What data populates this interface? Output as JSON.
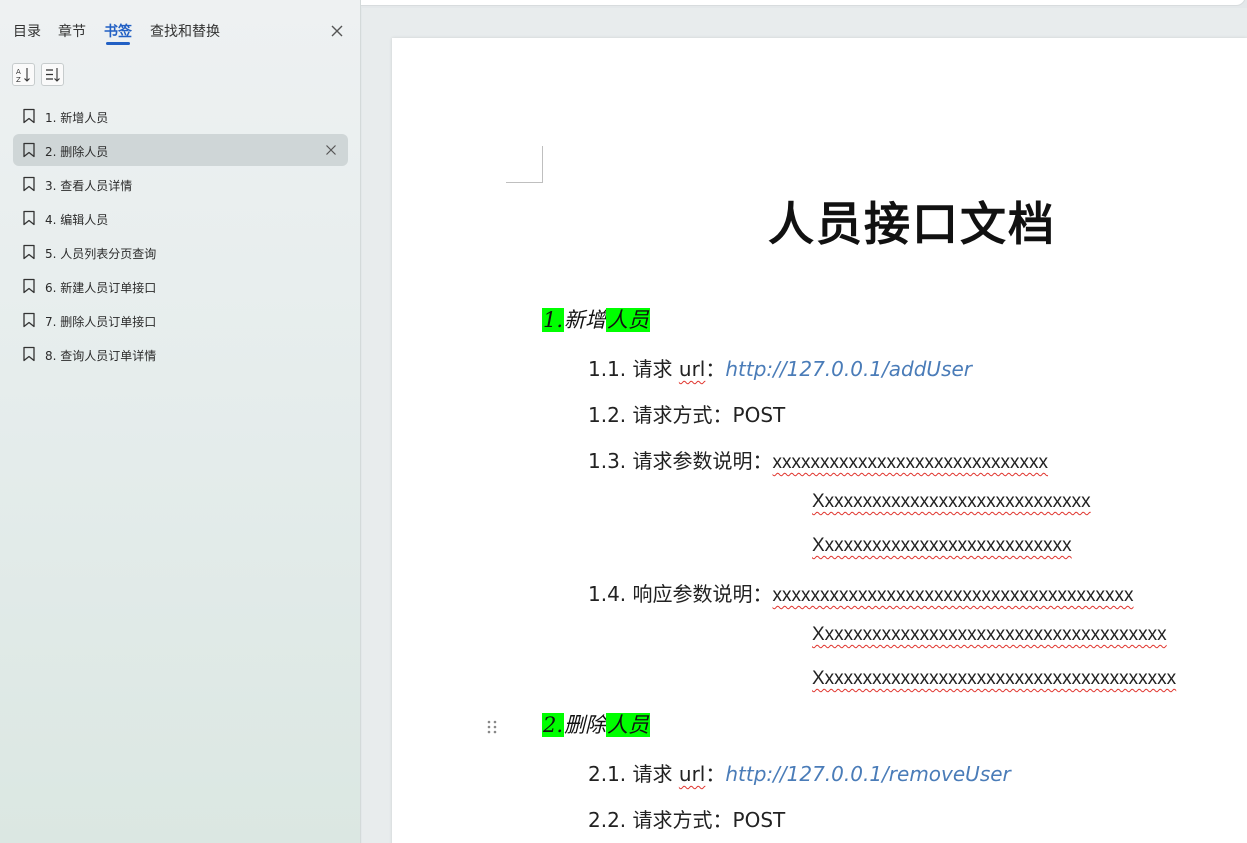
{
  "panel": {
    "tabs": [
      {
        "label": "目录"
      },
      {
        "label": "章节"
      },
      {
        "label": "书签"
      },
      {
        "label": "查找和替换"
      }
    ],
    "active_tab": "书签",
    "bookmarks": [
      {
        "label": "1. 新增人员"
      },
      {
        "label": "2. 删除人员"
      },
      {
        "label": "3. 查看人员详情"
      },
      {
        "label": "4. 编辑人员"
      },
      {
        "label": "5. 人员列表分页查询"
      },
      {
        "label": "6. 新建人员订单接口"
      },
      {
        "label": "7. 删除人员订单接口"
      },
      {
        "label": "8. 查询人员订单详情"
      }
    ],
    "selected_bookmark": "2. 删除人员"
  },
  "document": {
    "title": "人员接口文档",
    "sections": [
      {
        "number": "1.",
        "name_plain": "新增",
        "name_highlight": "人员",
        "items": [
          {
            "number": "1.1.",
            "label": "请求",
            "label_suffix": "url",
            "colon": "：",
            "value": "http://127.0.0.1/addUser"
          },
          {
            "number": "1.2.",
            "label": "请求方式：",
            "value": "POST"
          },
          {
            "number": "1.3.",
            "label": "请求参数说明：",
            "value": "xxxxxxxxxxxxxxxxxxxxxxxxxxxxx",
            "continuation": [
              "Xxxxxxxxxxxxxxxxxxxxxxxxxxxxx",
              "Xxxxxxxxxxxxxxxxxxxxxxxxxxx"
            ]
          },
          {
            "number": "1.4.",
            "label": "响应参数说明：",
            "value": "xxxxxxxxxxxxxxxxxxxxxxxxxxxxxxxxxxxxxx",
            "continuation": [
              "Xxxxxxxxxxxxxxxxxxxxxxxxxxxxxxxxxxxxx",
              "Xxxxxxxxxxxxxxxxxxxxxxxxxxxxxxxxxxxxxx"
            ]
          }
        ]
      },
      {
        "number": "2.",
        "name_plain": "删除",
        "name_highlight": "人员",
        "items": [
          {
            "number": "2.1.",
            "label": "请求",
            "label_suffix": "url",
            "colon": "：",
            "value": "http://127.0.0.1/removeUser"
          },
          {
            "number": "2.2.",
            "label": "请求方式：",
            "value": "POST"
          }
        ]
      }
    ]
  },
  "colors": {
    "accent": "#2260c4",
    "highlight": "#00ff00",
    "link": "#4a7cb8",
    "spellcheck": "#e0332c"
  }
}
